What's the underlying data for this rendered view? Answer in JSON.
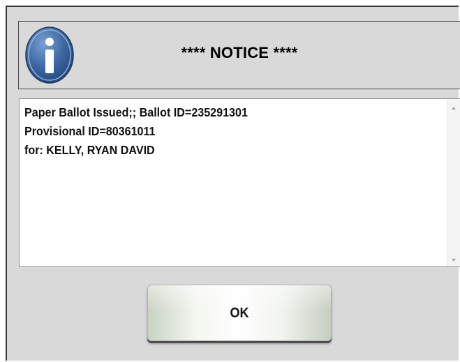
{
  "dialog": {
    "title": "**** NOTICE ****",
    "icon": "info-icon",
    "message_lines": [
      "Paper Ballot Issued;; Ballot ID=235291301",
      "Provisional ID=80361011",
      "for: KELLY, RYAN DAVID"
    ],
    "ok_label": "OK"
  },
  "colors": {
    "dialog_background": "#d9d9d9",
    "icon_blue": "#3f68a3",
    "message_background": "#ffffff"
  }
}
